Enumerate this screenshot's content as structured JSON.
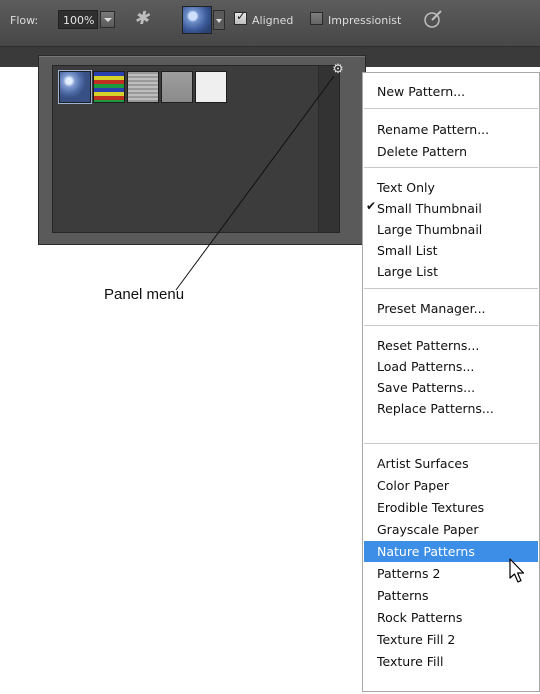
{
  "options_bar": {
    "flow_label": "Flow:",
    "flow_value": "100%",
    "aligned_label": "Aligned",
    "aligned_checked": true,
    "impressionist_label": "Impressionist",
    "impressionist_checked": false
  },
  "callout": {
    "label": "Panel menu"
  },
  "menu": {
    "items": [
      "New Pattern...",
      "Rename Pattern...",
      "Delete Pattern",
      "Text Only",
      "Small Thumbnail",
      "Large Thumbnail",
      "Small List",
      "Large List",
      "Preset Manager...",
      "Reset Patterns...",
      "Load Patterns...",
      "Save Patterns...",
      "Replace Patterns...",
      "Artist Surfaces",
      "Color Paper",
      "Erodible Textures",
      "Grayscale Paper",
      "Nature Patterns",
      "Patterns 2",
      "Patterns",
      "Rock Patterns",
      "Texture Fill 2",
      "Texture Fill"
    ],
    "checked_item": "Small Thumbnail",
    "highlighted_item": "Nature Patterns",
    "highlight_color": "#3d8ee6"
  }
}
